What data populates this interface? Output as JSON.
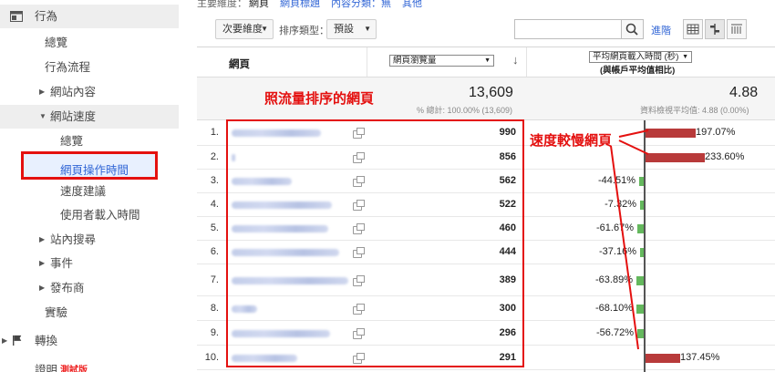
{
  "sidebar": {
    "behavior": {
      "label": "行為",
      "icon": "layout-icon"
    },
    "overview": "總覽",
    "flow": "行為流程",
    "site_content": "網站內容",
    "site_speed": "網站速度",
    "speed_overview": "總覽",
    "page_timings": "網頁操作時間",
    "speed_suggestions": "速度建議",
    "user_timings": "使用者載入時間",
    "site_search": "站內搜尋",
    "events": "事件",
    "publisher": "發布商",
    "experiments": "實驗",
    "conversions": {
      "label": "轉換",
      "icon": "flag-icon"
    },
    "last_item": "證明",
    "beta_badge": "測試版"
  },
  "topnav": {
    "primary_dimension_label": "主要維度：",
    "page": "網頁",
    "page_title": "網頁標題",
    "content_grouping": "內容分類：無",
    "other": "其他"
  },
  "controls": {
    "secondary_dimension": "次要維度",
    "sort_type_label": "排序類型：",
    "sort_type_value": "預設",
    "search_placeholder": "",
    "advanced": "進階"
  },
  "table": {
    "col_page": "網頁",
    "col_pageviews": "網頁瀏覽量",
    "col_load_metric": "平均網頁載入時間 (秒)",
    "col_load_subtitle": "(與帳戶平均值相比)",
    "total_pageviews": "13,609",
    "total_pageviews_note": "% 總計: 100.00% (13,609)",
    "avg_load": "4.88",
    "avg_load_note": "資料檢視平均值: 4.88 (0.00%)",
    "rows": [
      {
        "num": "1.",
        "pageviews": "990",
        "compare": "197.07%",
        "value": 197.07
      },
      {
        "num": "2.",
        "pageviews": "856",
        "compare": "233.60%",
        "value": 233.6
      },
      {
        "num": "3.",
        "pageviews": "562",
        "compare": "-44.51%",
        "value": -44.51
      },
      {
        "num": "4.",
        "pageviews": "522",
        "compare": "-7.32%",
        "value": -7.32
      },
      {
        "num": "5.",
        "pageviews": "460",
        "compare": "-61.67%",
        "value": -61.67
      },
      {
        "num": "6.",
        "pageviews": "444",
        "compare": "-37.16%",
        "value": -37.16
      },
      {
        "num": "7.",
        "pageviews": "389",
        "compare": "-63.89%",
        "value": -63.89
      },
      {
        "num": "8.",
        "pageviews": "300",
        "compare": "-68.10%",
        "value": -68.1
      },
      {
        "num": "9.",
        "pageviews": "296",
        "compare": "-56.72%",
        "value": -56.72
      },
      {
        "num": "10.",
        "pageviews": "291",
        "compare": "137.45%",
        "value": 137.45
      }
    ]
  },
  "annotations": {
    "traffic_sorted": "照流量排序的網頁",
    "slow_pages": "速度較慢網頁"
  },
  "colors": {
    "highlight_red": "#e4100f",
    "bar_slow": "#b83a3a",
    "bar_fast": "#64b85d",
    "link_blue": "#3367d6"
  }
}
